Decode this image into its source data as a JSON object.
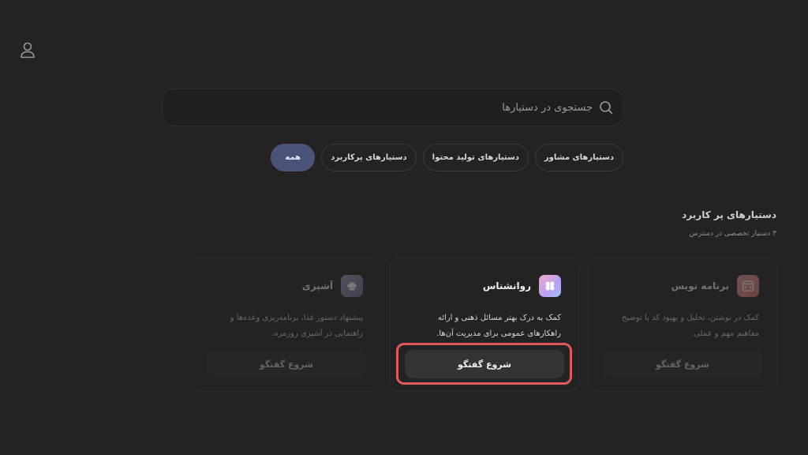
{
  "search": {
    "placeholder": "جستجوی در دستیارها"
  },
  "filters": [
    {
      "label": "همه",
      "active": true
    },
    {
      "label": "دستیارهای پرکاربرد",
      "active": false
    },
    {
      "label": "دستیارهای تولید محتوا",
      "active": false
    },
    {
      "label": "دستیارهای مشاور",
      "active": false
    }
  ],
  "section": {
    "title": "دستیارهای پر کاربرد",
    "subtitle": "۳ دستیار تخصصی در دسترس"
  },
  "cards": [
    {
      "title": "برنامه نویس",
      "description": "کمک در نوشتن، تحلیل و بهبود کد با توضیح مفاهیم مهم و عملی.",
      "button": "شروع گفتگو",
      "icon": "code-window-icon",
      "accent": "#e58a8a"
    },
    {
      "title": "روانشناس",
      "description": "کمک به درک بهتر مسائل ذهنی و ارائه راهکارهای عمومی برای مدیریت آن‌ها.",
      "button": "شروع گفتگو",
      "icon": "brain-icon",
      "accent": "#c9a6f2"
    },
    {
      "title": "آشپزی",
      "description": "پیشنهاد دستور غذا، برنامه‌ریزی وعده‌ها و راهنمایی در آشپزی روزمره.",
      "button": "شروع گفتگو",
      "icon": "chef-hat-icon",
      "accent": "#8a8fa8"
    }
  ]
}
